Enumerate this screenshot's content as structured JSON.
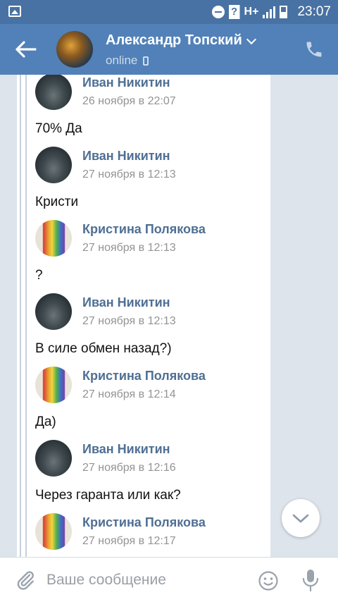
{
  "statusbar": {
    "network": "H+",
    "time": "23:07"
  },
  "header": {
    "title": "Александр Топский",
    "status": "online"
  },
  "messages": [
    {
      "author": "Иван Никитин",
      "date": "26 ноября в 22:07",
      "text": "70% Да",
      "avatar": "ivan"
    },
    {
      "author": "Иван Никитин",
      "date": "27 ноября в 12:13",
      "text": "Кристи",
      "avatar": "ivan"
    },
    {
      "author": "Кристина Полякова",
      "date": "27 ноября в 12:13",
      "text": "?",
      "avatar": "kristina"
    },
    {
      "author": "Иван Никитин",
      "date": "27 ноября в 12:13",
      "text": "В силе обмен назад?)",
      "avatar": "ivan"
    },
    {
      "author": "Кристина Полякова",
      "date": "27 ноября в 12:14",
      "text": "Да)",
      "avatar": "kristina"
    },
    {
      "author": "Иван Никитин",
      "date": "27 ноября в 12:16",
      "text": "Через гаранта или как?",
      "avatar": "ivan"
    },
    {
      "author": "Кристина Полякова",
      "date": "27 ноября в 12:17",
      "text": "",
      "avatar": "kristina"
    }
  ],
  "composer": {
    "placeholder": "Ваше сообщение",
    "value": ""
  },
  "icons": {
    "back": "arrow-left-icon",
    "call": "phone-icon",
    "attach": "paperclip-icon",
    "emoji": "smile-icon",
    "mic": "microphone-icon",
    "scroll": "chevron-down-icon"
  },
  "colors": {
    "header": "#5181b8",
    "statusbar": "#4872a3",
    "author_link": "#4f6f94",
    "chat_bg": "#dee4ec"
  }
}
